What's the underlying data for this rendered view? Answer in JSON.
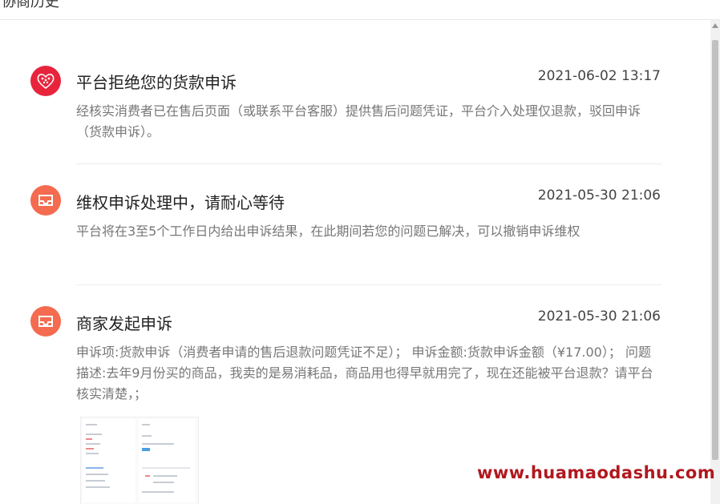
{
  "header": {
    "title": "协商历史"
  },
  "entries": [
    {
      "icon": "heart-pattern-icon",
      "title": "平台拒绝您的货款申诉",
      "time": "2021-06-02 13:17",
      "body": "经核实消费者已在售后页面（或联系平台客服）提供售后问题凭证，平台介入处理仅退款，驳回申诉（货款申诉）。"
    },
    {
      "icon": "inbox-icon",
      "title": "维权申诉处理中，请耐心等待",
      "time": "2021-05-30 21:06",
      "body": "平台将在3至5个工作日内给出申诉结果，在此期间若您的问题已解决，可以撤销申诉维权"
    },
    {
      "icon": "inbox-icon",
      "title": "商家发起申诉",
      "time": "2021-05-30 21:06",
      "body": "申诉项:货款申诉（消费者申请的售后退款问题凭证不足）； 申诉金额:货款申诉金额（¥17.00）； 问题描述:去年9月份买的商品，我卖的是易消耗品，商品用也得早就用完了，现在还能被平台退款？请平台核实清楚，；"
    }
  ],
  "watermark": "www.huamaodashu.com",
  "colors": {
    "red_icon": "#e8243c",
    "orange_icon": "#f46b50",
    "watermark": "#b0181e"
  }
}
